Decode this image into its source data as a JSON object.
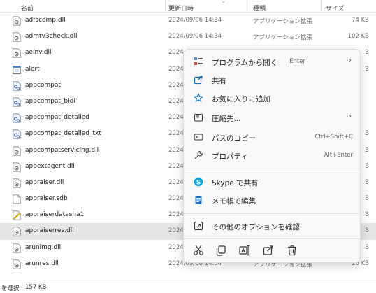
{
  "header": {
    "name": "名前",
    "date": "更新日時",
    "type": "種類",
    "size": "サイズ"
  },
  "files": [
    {
      "name": "adfscomp.dll",
      "date": "2024/09/06 14:34",
      "type": "アプリケーション拡張",
      "size": "74 KB",
      "icon": "dll-file-icon"
    },
    {
      "name": "admtv3check.dll",
      "date": "2024/09/06 14:34",
      "type": "アプリケーション拡張",
      "size": "102 KB",
      "icon": "dll-file-icon"
    },
    {
      "name": "aeinv.dll",
      "date": "2024",
      "type": "",
      "size": "B",
      "icon": "dll-file-icon"
    },
    {
      "name": "alert",
      "date": "2024",
      "type": "",
      "size": "B",
      "icon": "app-file-icon"
    },
    {
      "name": "appcompat",
      "date": "2024",
      "type": "",
      "size": "",
      "icon": "system-file-icon"
    },
    {
      "name": "appcompat_bidi",
      "date": "2024",
      "type": "",
      "size": "",
      "icon": "system-file-icon"
    },
    {
      "name": "appcompat_detailed",
      "date": "2024",
      "type": "",
      "size": "",
      "icon": "system-file-icon"
    },
    {
      "name": "appcompat_detailed_txt",
      "date": "2024",
      "type": "",
      "size": "B",
      "icon": "system-file-icon"
    },
    {
      "name": "appcompatservicing.dll",
      "date": "2024",
      "type": "",
      "size": "B",
      "icon": "dll-file-icon"
    },
    {
      "name": "appextagent.dll",
      "date": "2024",
      "type": "",
      "size": "B",
      "icon": "dll-file-icon"
    },
    {
      "name": "appraiser.dll",
      "date": "2024",
      "type": "",
      "size": "B",
      "icon": "dll-file-icon"
    },
    {
      "name": "appraiser.sdb",
      "date": "2024",
      "type": "",
      "size": "B",
      "icon": "blank-file-icon"
    },
    {
      "name": "appraiserdatasha1",
      "date": "2024",
      "type": "",
      "size": "B",
      "icon": "key-file-icon"
    },
    {
      "name": "appraiserres.dll",
      "date": "2024",
      "type": "",
      "size": "B",
      "icon": "dll-file-icon",
      "selected": true
    },
    {
      "name": "arunimg.dll",
      "date": "2024",
      "type": "",
      "size": "B",
      "icon": "dll-file-icon"
    },
    {
      "name": "arunres.dll",
      "date": "2024/09/06 14:34",
      "type": "アプリケーション拡張",
      "size": "26 KB",
      "icon": "dll-file-icon"
    }
  ],
  "status": {
    "selection": "を選択",
    "size": "157 KB"
  },
  "menu": {
    "open_with": {
      "label": "プログラムから開く",
      "shortcut": "Enter"
    },
    "share": {
      "label": "共有"
    },
    "favorite": {
      "label": "お気に入りに追加"
    },
    "compress": {
      "label": "圧縮先..."
    },
    "copy_path": {
      "label": "パスのコピー",
      "shortcut": "Ctrl+Shift+C"
    },
    "properties": {
      "label": "プロパティ",
      "shortcut": "Alt+Enter"
    },
    "skype_share": {
      "label": "Skype で共有"
    },
    "notepad_edit": {
      "label": "メモ帳で編集"
    },
    "more_options": {
      "label": "その他のオプションを確認"
    }
  },
  "colors": {
    "accent": "#0067c0",
    "skype": "#00a8e8",
    "notepad": "#1f6fd1",
    "selected_row": "#e6e6e6"
  }
}
